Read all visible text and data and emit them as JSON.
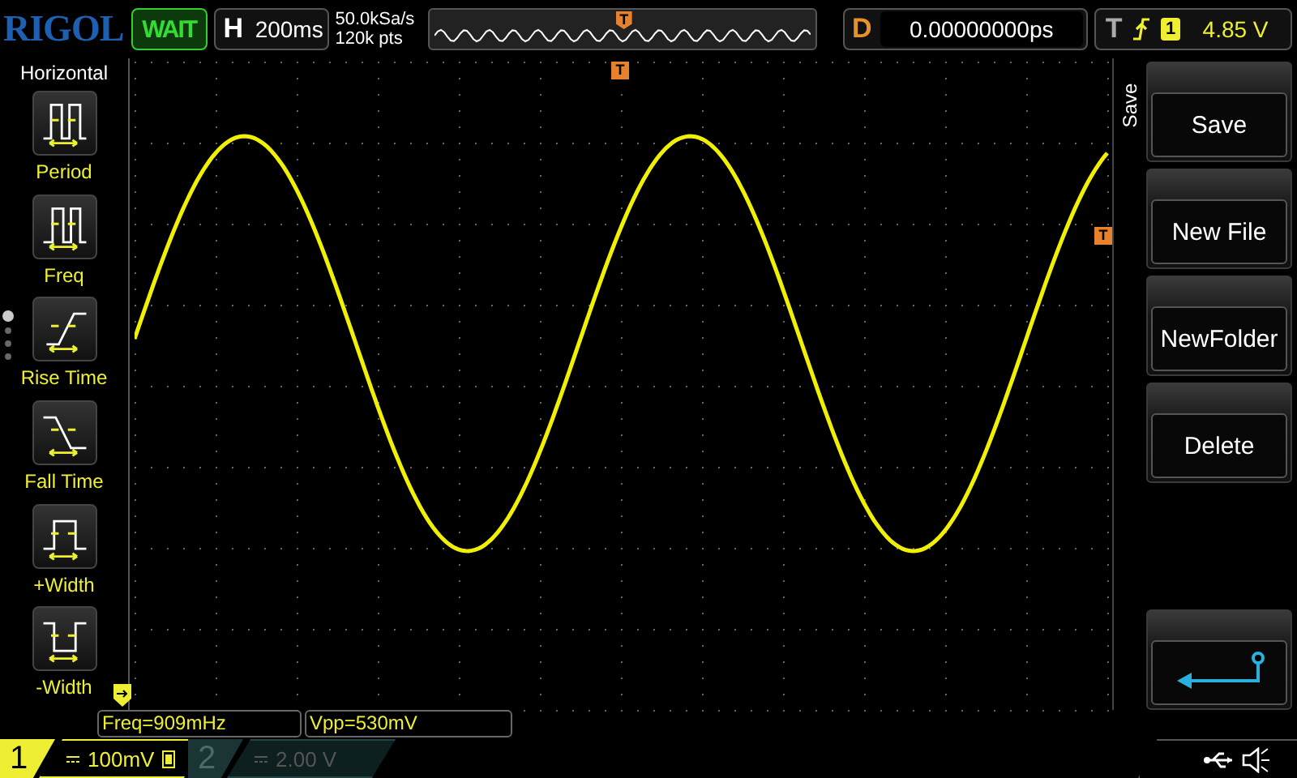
{
  "top_bar": {
    "logo": "RIGOL",
    "run_status": "WAIT",
    "timebase": {
      "label": "H",
      "value": "200ms"
    },
    "sample_rate": "50.0kSa/s",
    "memory_depth": "120k pts",
    "overview": {
      "trigger_marker": "T"
    },
    "delay": {
      "label": "D",
      "value": "0.00000000ps"
    },
    "trigger": {
      "label": "T",
      "source": "1",
      "level": "4.85 V"
    }
  },
  "sidebar": {
    "title": "Horizontal",
    "items": [
      {
        "kind": "period",
        "label": "Period"
      },
      {
        "kind": "freq",
        "label": "Freq"
      },
      {
        "kind": "rise",
        "label": "Rise Time"
      },
      {
        "kind": "fall",
        "label": "Fall Time"
      },
      {
        "kind": "pwidth",
        "label": "+Width"
      },
      {
        "kind": "nwidth",
        "label": "-Width"
      }
    ]
  },
  "plot": {
    "trigger_position_marker": "T",
    "trigger_level_marker": "T"
  },
  "menu": {
    "title": "Save",
    "buttons": [
      {
        "kind": "text",
        "label": "Save"
      },
      {
        "kind": "text",
        "label": "New File"
      },
      {
        "kind": "text",
        "label": "NewFolder"
      },
      {
        "kind": "text",
        "label": "Delete"
      },
      {
        "kind": "spacer"
      },
      {
        "kind": "back"
      }
    ]
  },
  "measurements": [
    "Freq=909mHz",
    "Vpp=530mV"
  ],
  "channels": [
    {
      "number": "1",
      "scale": "100mV",
      "on": true
    },
    {
      "number": "2",
      "scale": "2.00 V",
      "on": false
    }
  ]
}
